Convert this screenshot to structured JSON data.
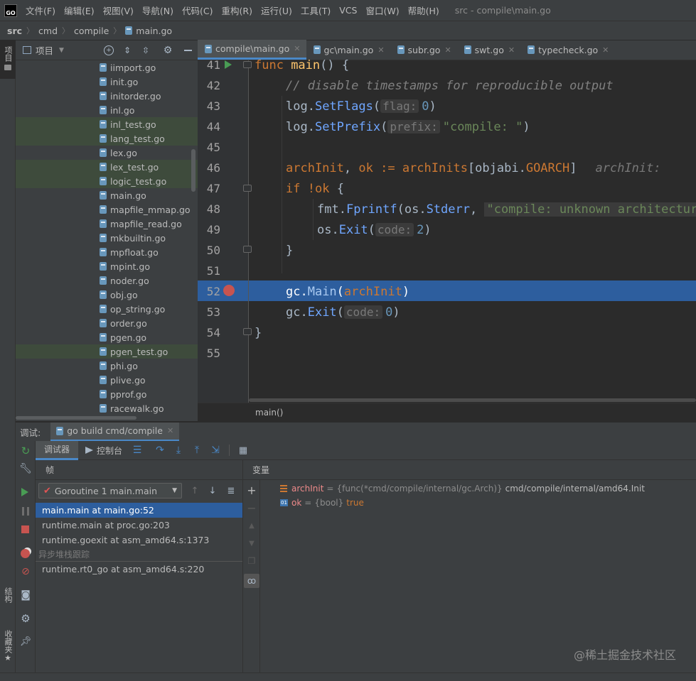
{
  "menubar": {
    "logo": "GO",
    "items": [
      "文件(F)",
      "编辑(E)",
      "视图(V)",
      "导航(N)",
      "代码(C)",
      "重构(R)",
      "运行(U)",
      "工具(T)",
      "VCS",
      "窗口(W)",
      "帮助(H)"
    ],
    "title": "src - compile\\main.go"
  },
  "navbar": {
    "crumbs": [
      "src",
      "cmd",
      "compile",
      "main.go"
    ]
  },
  "left_stripe": {
    "project_label": "项目",
    "structure_label": "结构",
    "favorites_label": "收藏夹"
  },
  "project_panel": {
    "title": "项目",
    "files": [
      {
        "name": "iimport.go",
        "highlighted": false
      },
      {
        "name": "init.go",
        "highlighted": false
      },
      {
        "name": "initorder.go",
        "highlighted": false
      },
      {
        "name": "inl.go",
        "highlighted": false
      },
      {
        "name": "inl_test.go",
        "highlighted": true
      },
      {
        "name": "lang_test.go",
        "highlighted": true
      },
      {
        "name": "lex.go",
        "highlighted": false
      },
      {
        "name": "lex_test.go",
        "highlighted": true
      },
      {
        "name": "logic_test.go",
        "highlighted": true
      },
      {
        "name": "main.go",
        "highlighted": false
      },
      {
        "name": "mapfile_mmap.go",
        "highlighted": false
      },
      {
        "name": "mapfile_read.go",
        "highlighted": false
      },
      {
        "name": "mkbuiltin.go",
        "highlighted": false
      },
      {
        "name": "mpfloat.go",
        "highlighted": false
      },
      {
        "name": "mpint.go",
        "highlighted": false
      },
      {
        "name": "noder.go",
        "highlighted": false
      },
      {
        "name": "obj.go",
        "highlighted": false
      },
      {
        "name": "op_string.go",
        "highlighted": false
      },
      {
        "name": "order.go",
        "highlighted": false
      },
      {
        "name": "pgen.go",
        "highlighted": false
      },
      {
        "name": "pgen_test.go",
        "highlighted": true
      },
      {
        "name": "phi.go",
        "highlighted": false
      },
      {
        "name": "plive.go",
        "highlighted": false
      },
      {
        "name": "pprof.go",
        "highlighted": false
      },
      {
        "name": "racewalk.go",
        "highlighted": false
      }
    ]
  },
  "tabs": [
    "compile\\main.go",
    "gc\\main.go",
    "subr.go",
    "swt.go",
    "typecheck.go"
  ],
  "editor": {
    "line_numbers": [
      "41",
      "42",
      "43",
      "44",
      "45",
      "46",
      "47",
      "48",
      "49",
      "50",
      "51",
      "52",
      "53",
      "54",
      "55"
    ],
    "code": {
      "l41_kw": "func ",
      "l41_fn": "main",
      "l41_rest": "() {",
      "l42": "// disable timestamps for reproducible output",
      "l43_a": "log.",
      "l43_b": "SetFlags",
      "l43_c": "(",
      "l43_hint": "flag:",
      "l43_num": "0",
      "l43_d": ")",
      "l44_a": "log.",
      "l44_b": "SetPrefix",
      "l44_c": "(",
      "l44_hint": "prefix:",
      "l44_str": "\"compile: \"",
      "l44_d": ")",
      "l46_a": "archInit",
      "l46_b": ", ",
      "l46_c": "ok",
      "l46_d": " := ",
      "l46_e": "archInits",
      "l46_f": "[objabi.",
      "l46_g": "GOARCH",
      "l46_h": "]",
      "l46_hint": "archInit: ",
      "l47_kw": "if ",
      "l47_op": "!",
      "l47_ok": "ok",
      "l47_rest": " {",
      "l48_a": "fmt.",
      "l48_b": "Fprintf",
      "l48_c": "(os.",
      "l48_d": "Stderr",
      "l48_e": ", ",
      "l48_str": "\"compile: unknown architecture",
      "l49_a": "os.",
      "l49_b": "Exit",
      "l49_c": "(",
      "l49_hint": "code:",
      "l49_num": "2",
      "l49_d": ")",
      "l50": "}",
      "l52_a": "gc.",
      "l52_b": "Main",
      "l52_c": "(",
      "l52_d": "archInit",
      "l52_e": ")",
      "l53_a": "gc.",
      "l53_b": "Exit",
      "l53_c": "(",
      "l53_hint": "code:",
      "l53_num": "0",
      "l53_d": ")",
      "l54": "}"
    },
    "breadcrumb": "main()"
  },
  "debug": {
    "title": "调试:",
    "run_config": "go build cmd/compile",
    "tabs": {
      "debugger": "调试器",
      "console": "控制台"
    },
    "frames_label": "帧",
    "variables_label": "变量",
    "goroutine": "Goroutine 1 main.main",
    "frames": [
      "main.main at main.go:52",
      "runtime.main at proc.go:203",
      "runtime.goexit at asm_amd64.s:1373"
    ],
    "async_label": "异步堆栈跟踪",
    "async_frames": [
      "runtime.rt0_go at asm_amd64.s:220"
    ],
    "variables": [
      {
        "name": "archInit",
        "type": "{func(*cmd/compile/internal/gc.Arch)}",
        "value": "cmd/compile/internal/amd64.Init"
      },
      {
        "name": "ok",
        "type": "{bool}",
        "value": "true"
      }
    ]
  },
  "watermark": "@稀土掘金技术社区",
  "colors": {
    "accent": "#2d5e9e",
    "breakpoint": "#c75450",
    "run_green": "#499c54"
  }
}
